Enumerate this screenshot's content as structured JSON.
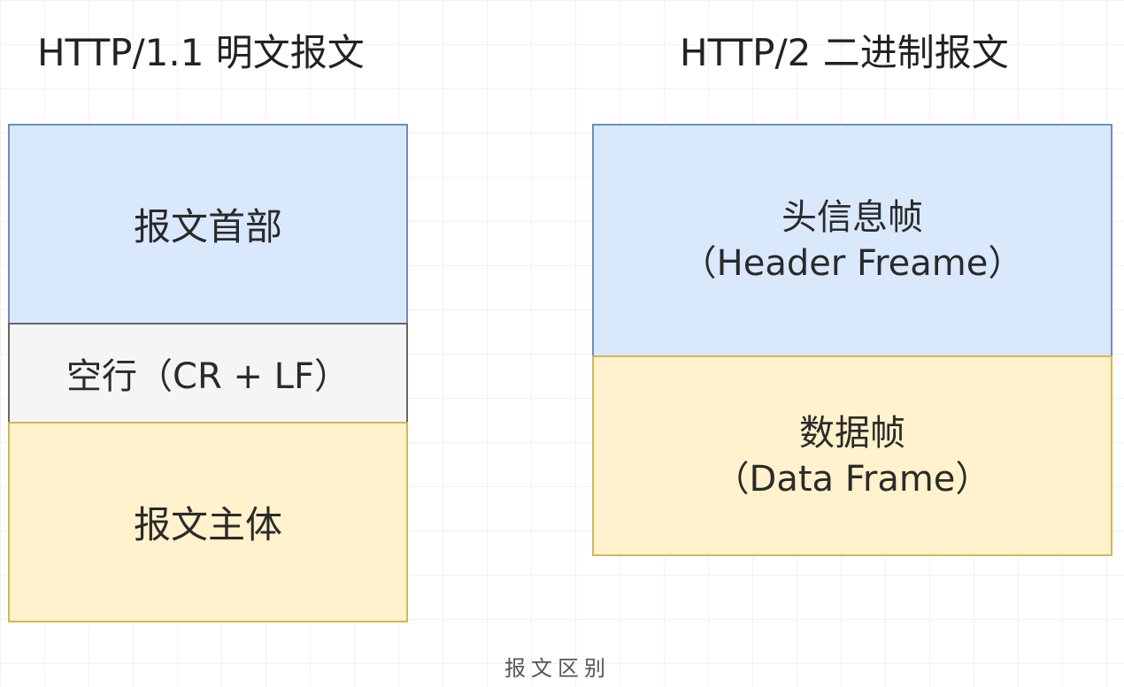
{
  "titles": {
    "http11": "HTTP/1.1 明文报文",
    "http2": "HTTP/2 二进制报文"
  },
  "http11": {
    "header": "报文首部",
    "blank_line": "空行（CR + LF）",
    "body": "报文主体"
  },
  "http2": {
    "header_frame": {
      "line1": "头信息帧",
      "line2": "（Header Freame）"
    },
    "data_frame": {
      "line1": "数据帧",
      "line2": "（Data Frame）"
    }
  },
  "caption": "报文区别",
  "colors": {
    "blue_fill": "#dae8fc",
    "blue_stroke": "#6c8ebf",
    "grey_fill": "#f5f5f5",
    "grey_stroke": "#666666",
    "yellow_fill": "#fff2cc",
    "yellow_stroke": "#d6b656"
  }
}
